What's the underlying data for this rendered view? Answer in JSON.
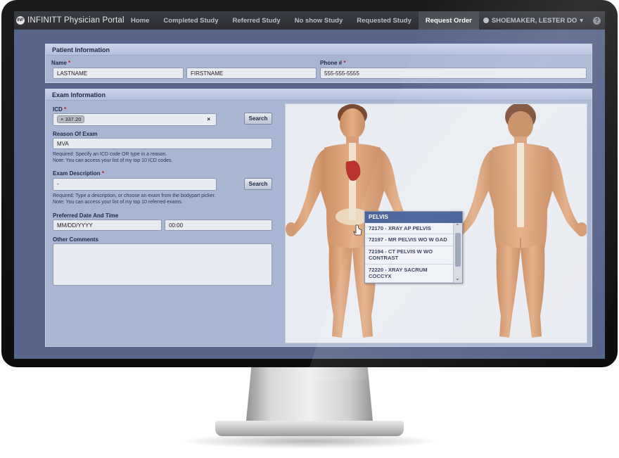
{
  "nav": {
    "logo_mark": "INF",
    "brand": "INFINITT Physician Portal",
    "items": [
      {
        "label": "Home"
      },
      {
        "label": "Completed Study"
      },
      {
        "label": "Referred Study"
      },
      {
        "label": "No show Study"
      },
      {
        "label": "Requested Study"
      },
      {
        "label": "Request Order",
        "active": true
      }
    ],
    "user": "SHOEMAKER, LESTER DO",
    "user_caret": "▾",
    "help": "?"
  },
  "patient": {
    "header": "Patient Information",
    "name_label": "Name",
    "phone_label": "Phone #",
    "required_mark": "*",
    "lastname": "LASTNAME",
    "firstname": "FIRSTNAME",
    "phone": "555-555-5555"
  },
  "exam": {
    "header": "Exam Information",
    "icd_label": "ICD",
    "icd_chip": "× 337.20",
    "icd_clear": "×",
    "search_label": "Search",
    "reason_label": "Reason Of Exam",
    "reason_value": "MVA",
    "reason_note_1": "Required: Specify an ICD code OR type in a reason.",
    "reason_note_2": "Note: You can access your list of my top 10 ICD codes.",
    "desc_label": "Exam Description",
    "desc_value": "-",
    "desc_note_1": "Required: Type a description, or choose an exam from the bodypart picker.",
    "desc_note_2": "Note: You can access your list of my top 10 referred exams.",
    "date_label": "Preferred Date And Time",
    "date_placeholder": "MM/DD/YYYY",
    "time_value": "00:00",
    "comments_label": "Other Comments"
  },
  "bodypart_picker": {
    "dropdown_title": "PELVIS",
    "items": [
      "72170 - XRAY AP PELVIS",
      "72197 - MR PELVIS WO W GAD",
      "72194 - CT PELVIS W WO CONTRAST",
      "72220 - XRAY SACRUM COCCYX"
    ],
    "scroll_up": "⌃",
    "scroll_down": "⌄"
  },
  "colors": {
    "nav_bg": "#2a2c31",
    "panel_bg": "#a9b6d3",
    "dropdown_header": "#3d5a94",
    "required": "#c0141c"
  }
}
